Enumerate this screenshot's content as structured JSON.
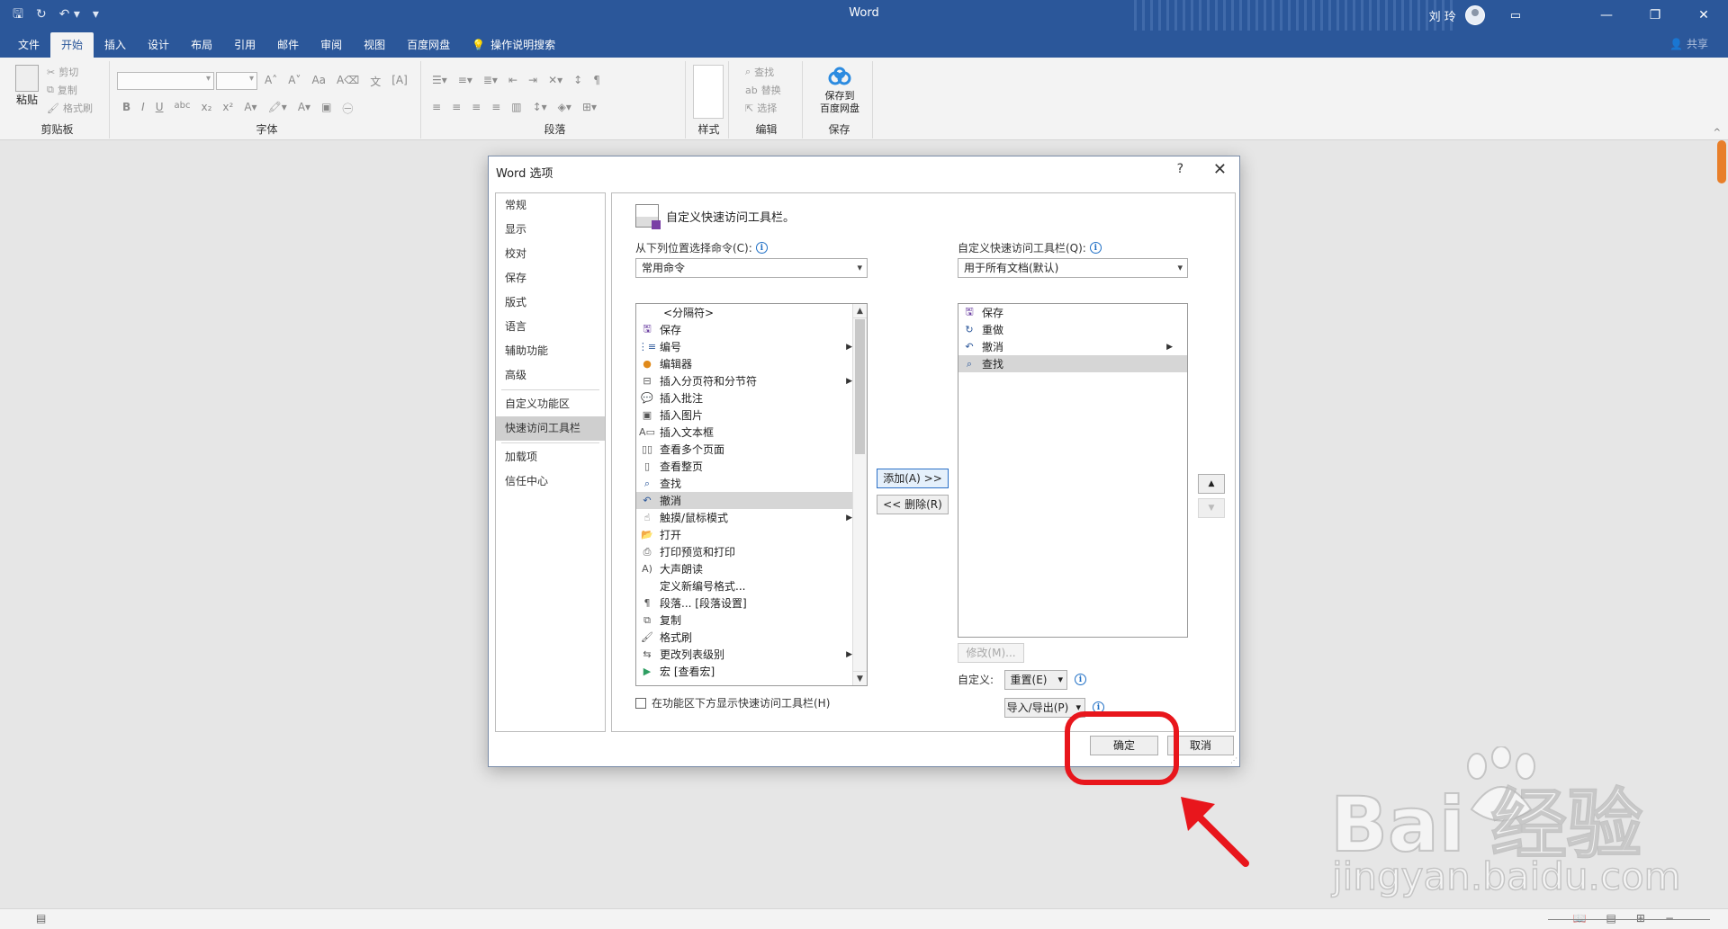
{
  "app": {
    "title": "Word",
    "user": "刘 玲",
    "tell_me": "操作说明搜索",
    "share": "共享"
  },
  "ribbon_tabs": [
    "文件",
    "开始",
    "插入",
    "设计",
    "布局",
    "引用",
    "邮件",
    "审阅",
    "视图",
    "百度网盘"
  ],
  "active_tab": "开始",
  "ribbon": {
    "clipboard": {
      "paste": "粘贴",
      "cut": "剪切",
      "copy": "复制",
      "format_painter": "格式刷",
      "label": "剪贴板"
    },
    "font": {
      "label": "字体",
      "bold": "B",
      "italic": "I",
      "underline": "U",
      "strike": "abc",
      "sub": "x₂",
      "sup": "x²"
    },
    "paragraph": {
      "label": "段落"
    },
    "styles": {
      "label": "样式"
    },
    "editing": {
      "find": "查找",
      "replace": "替换",
      "select": "选择",
      "label": "编辑"
    },
    "save": {
      "button": "保存到\n百度网盘",
      "button_line1": "保存到",
      "button_line2": "百度网盘",
      "label": "保存"
    }
  },
  "dialog": {
    "title": "Word 选项",
    "help": "?",
    "close": "✕",
    "nav": [
      "常规",
      "显示",
      "校对",
      "保存",
      "版式",
      "语言",
      "辅助功能",
      "高级",
      "自定义功能区",
      "快速访问工具栏",
      "加载项",
      "信任中心"
    ],
    "nav_selected": "快速访问工具栏",
    "section_title": "自定义快速访问工具栏。",
    "choose_label": "从下列位置选择命令(C):",
    "choose_value": "常用命令",
    "customize_label": "自定义快速访问工具栏(Q):",
    "customize_value": "用于所有文档(默认)",
    "commands": [
      {
        "label": "<分隔符>",
        "icon": "separator"
      },
      {
        "label": "保存",
        "icon": "save-icon"
      },
      {
        "label": "编号",
        "icon": "numbering-icon",
        "submenu": true
      },
      {
        "label": "编辑器",
        "icon": "editor-icon"
      },
      {
        "label": "插入分页符和分节符",
        "icon": "page-break-icon",
        "submenu": true
      },
      {
        "label": "插入批注",
        "icon": "comment-icon"
      },
      {
        "label": "插入图片",
        "icon": "picture-icon"
      },
      {
        "label": "插入文本框",
        "icon": "textbox-icon"
      },
      {
        "label": "查看多个页面",
        "icon": "multi-page-icon"
      },
      {
        "label": "查看整页",
        "icon": "one-page-icon"
      },
      {
        "label": "查找",
        "icon": "find-icon"
      },
      {
        "label": "撤消",
        "icon": "undo-icon",
        "submenu": true,
        "selected": true
      },
      {
        "label": "触摸/鼠标模式",
        "icon": "touch-icon",
        "submenu": true
      },
      {
        "label": "打开",
        "icon": "open-icon"
      },
      {
        "label": "打印预览和打印",
        "icon": "print-preview-icon"
      },
      {
        "label": "大声朗读",
        "icon": "read-aloud-icon"
      },
      {
        "label": "定义新编号格式...",
        "icon": "none"
      },
      {
        "label": "段落... [段落设置]",
        "icon": "paragraph-icon"
      },
      {
        "label": "复制",
        "icon": "copy-icon"
      },
      {
        "label": "格式刷",
        "icon": "format-painter-icon"
      },
      {
        "label": "更改列表级别",
        "icon": "list-level-icon",
        "submenu": true
      },
      {
        "label": "宏 [查看宏]",
        "icon": "macro-icon"
      }
    ],
    "toolbar_items": [
      {
        "label": "保存",
        "icon": "save-icon"
      },
      {
        "label": "重做",
        "icon": "redo-icon"
      },
      {
        "label": "撤消",
        "icon": "undo-icon",
        "submenu": true
      },
      {
        "label": "查找",
        "icon": "find-icon",
        "selected": true
      }
    ],
    "add_button": "添加(A) >>",
    "remove_button": "<< 删除(R)",
    "modify_button": "修改(M)...",
    "customizations_label": "自定义:",
    "reset_button": "重置(E)",
    "import_export_button": "导入/导出(P)",
    "show_below_ribbon": "在功能区下方显示快速访问工具栏(H)",
    "ok_button": "确定",
    "cancel_button": "取消"
  },
  "watermark": {
    "brand": "Bai 经验",
    "url": "jingyan.baidu.com"
  },
  "colors": {
    "titlebar": "#2b579a",
    "highlight": "#e8161c"
  }
}
